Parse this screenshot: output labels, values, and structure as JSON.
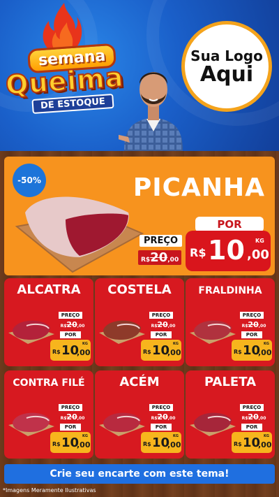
{
  "header": {
    "title_line1": "semana",
    "title_line2": "Queima",
    "title_line3": "DE ESTOQUE",
    "logo_line1": "Sua Logo",
    "logo_line2": "Aqui"
  },
  "featured": {
    "discount": "-50%",
    "name": "PICANHA",
    "preco_label": "PREÇO",
    "old_currency": "R$",
    "old_value": "20",
    "old_cents": ",00",
    "por_label": "POR",
    "currency": "R$",
    "value": "10",
    "cents": ",00",
    "unit": "KG"
  },
  "cards": [
    {
      "name": "ALCATRA",
      "preco_label": "PREÇO",
      "old_currency": "R$",
      "old_value": "20",
      "old_cents": ",00",
      "por_label": "POR",
      "currency": "R$",
      "value": "10",
      "cents": ",00",
      "unit": "KG"
    },
    {
      "name": "COSTELA",
      "preco_label": "PREÇO",
      "old_currency": "R$",
      "old_value": "20",
      "old_cents": ",00",
      "por_label": "POR",
      "currency": "R$",
      "value": "10",
      "cents": ",00",
      "unit": "KG"
    },
    {
      "name": "FRALDINHA",
      "preco_label": "PREÇO",
      "old_currency": "R$",
      "old_value": "20",
      "old_cents": ",00",
      "por_label": "POR",
      "currency": "R$",
      "value": "10",
      "cents": ",00",
      "unit": "KG"
    },
    {
      "name": "CONTRA FILÉ",
      "preco_label": "PREÇO",
      "old_currency": "R$",
      "old_value": "20",
      "old_cents": ",00",
      "por_label": "POR",
      "currency": "R$",
      "value": "10",
      "cents": ",00",
      "unit": "KG"
    },
    {
      "name": "ACÉM",
      "preco_label": "PREÇO",
      "old_currency": "R$",
      "old_value": "20",
      "old_cents": ",00",
      "por_label": "POR",
      "currency": "R$",
      "value": "10",
      "cents": ",00",
      "unit": "KG"
    },
    {
      "name": "PALETA",
      "preco_label": "PREÇO",
      "old_currency": "R$",
      "old_value": "20",
      "old_cents": ",00",
      "por_label": "POR",
      "currency": "R$",
      "value": "10",
      "cents": ",00",
      "unit": "KG"
    }
  ],
  "cta": {
    "label": "Crie seu encarte com este tema!"
  },
  "footer": {
    "disclaimer": "*Imagens Meramente Ilustrativas"
  },
  "colors": {
    "header_blue": "#1a5fc9",
    "featured_orange": "#f7931e",
    "card_red": "#d71920",
    "price_yellow": "#f7b51d",
    "cta_blue": "#1f6fe0"
  }
}
